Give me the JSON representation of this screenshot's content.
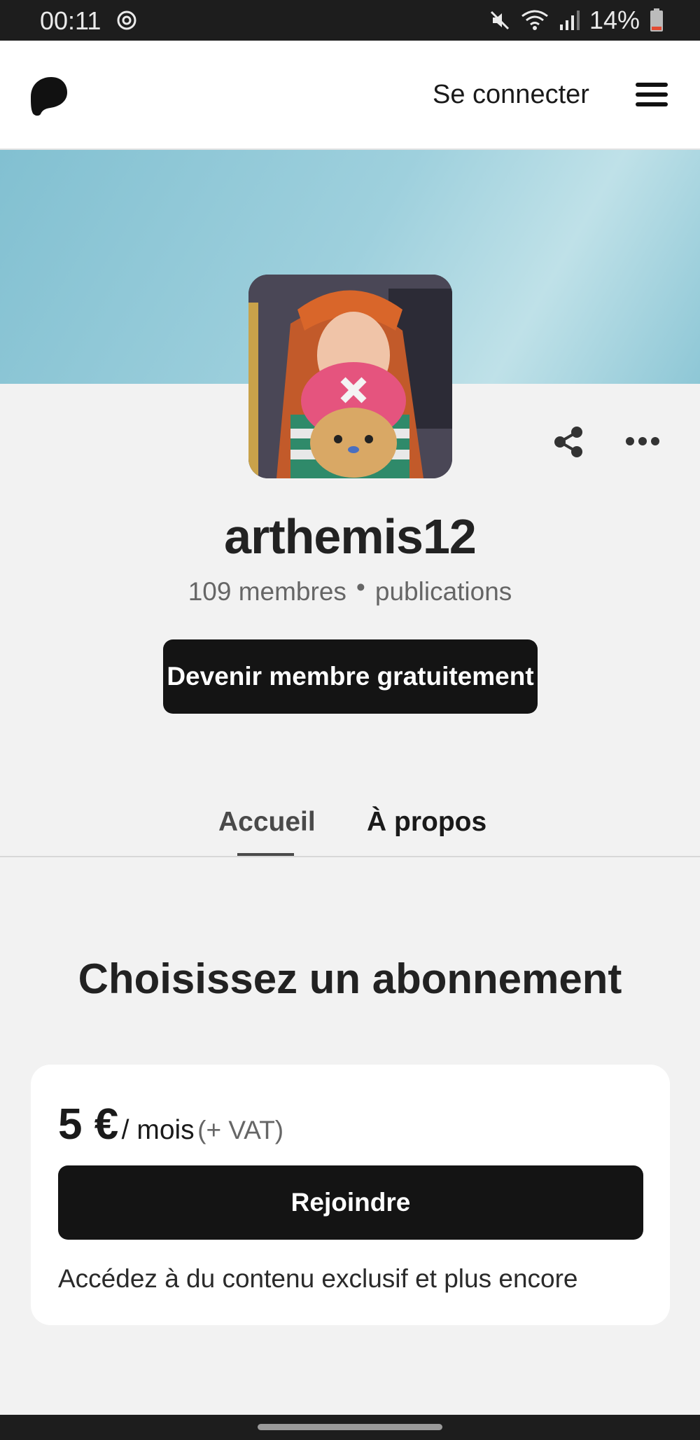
{
  "status_bar": {
    "time": "00:11",
    "battery": "14%"
  },
  "header": {
    "signin_label": "Se connecter"
  },
  "profile": {
    "name": "arthemis12",
    "members": "109 membres",
    "separator": "•",
    "posts": "publications",
    "join_free_label": "Devenir membre gratuitement"
  },
  "tabs": [
    {
      "label": "Accueil",
      "active": true
    },
    {
      "label": "À propos",
      "active": false
    }
  ],
  "tiers_section": {
    "title": "Choisissez un abonnement",
    "tier": {
      "amount": "5 €",
      "period": "/ mois",
      "vat": "(+ VAT)",
      "join_label": "Rejoindre",
      "description": "Accédez à du contenu exclusif et plus encore"
    }
  },
  "colors": {
    "button_bg": "#141414",
    "banner": "#9ed0dd",
    "page_bg": "#f2f2f2"
  }
}
